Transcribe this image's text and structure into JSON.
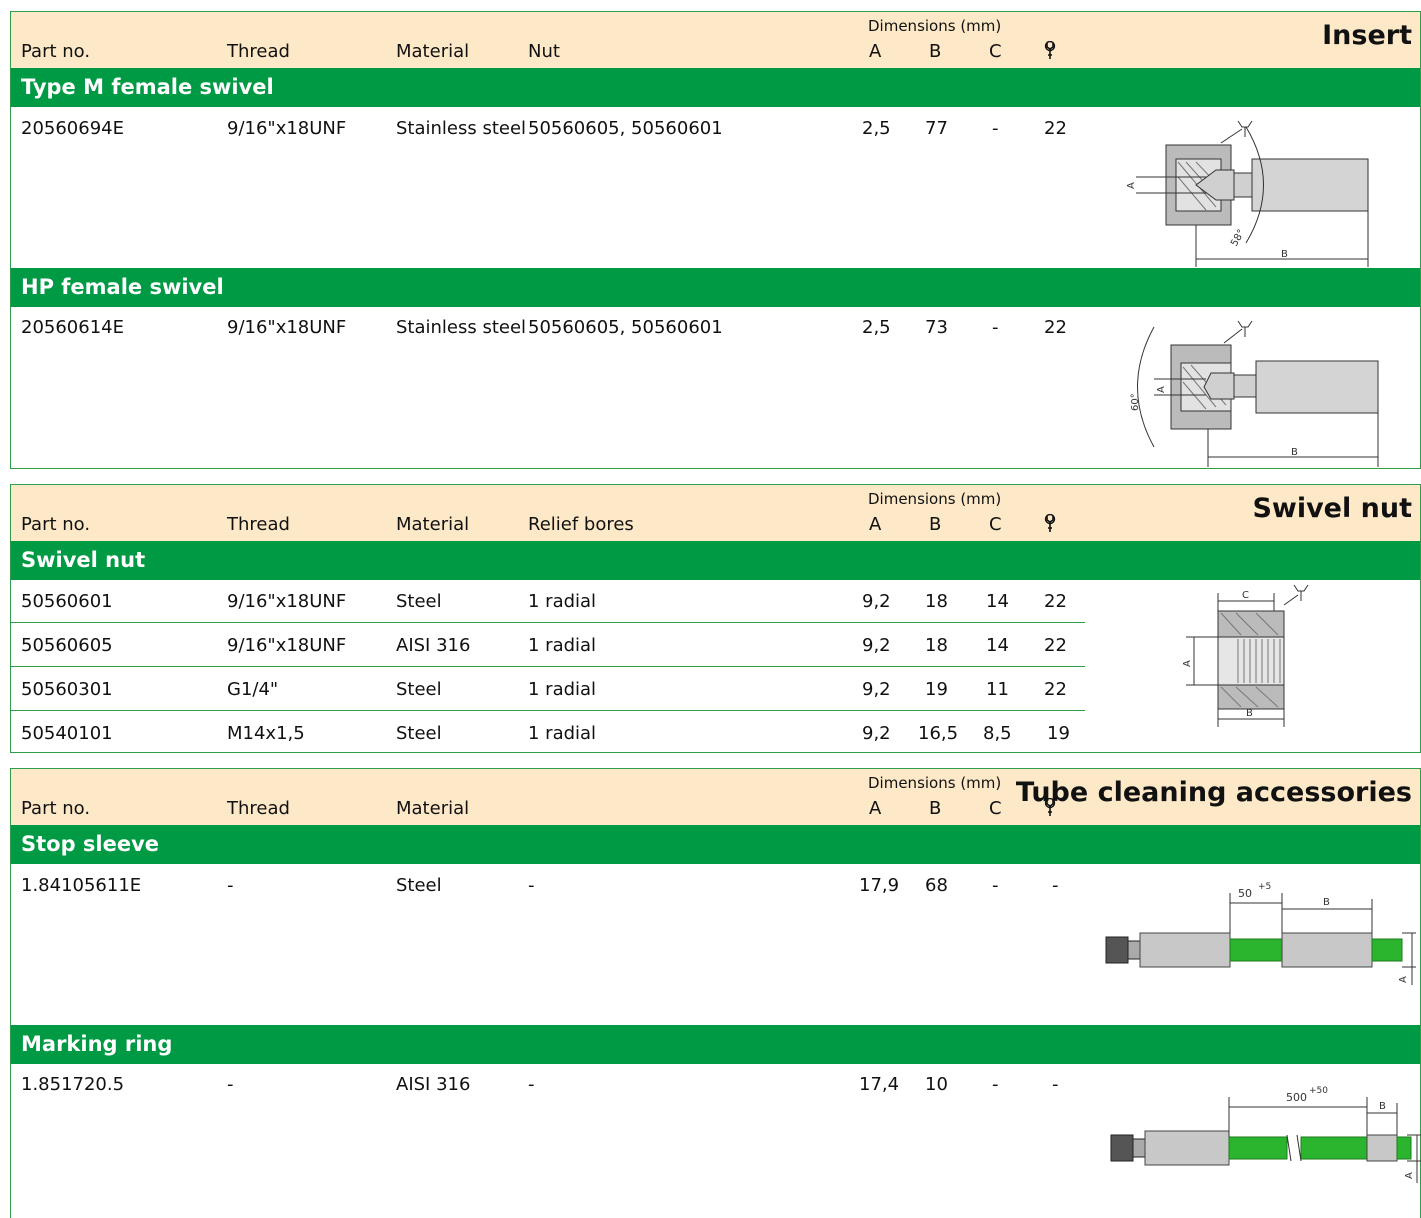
{
  "sections": [
    {
      "title": "Insert",
      "headers": {
        "part": "Part no.",
        "thread": "Thread",
        "material": "Material",
        "extra": "Nut",
        "dims": "Dimensions (mm)",
        "a": "A",
        "b": "B",
        "c": "C"
      },
      "groups": [
        {
          "name": "Type M female swivel",
          "rows": [
            {
              "part": "20560694E",
              "thread": "9/16\"x18UNF",
              "material": "Stainless steel",
              "extra": "50560605, 50560601",
              "a": "2,5",
              "b": "77",
              "c": "-",
              "w": "22"
            }
          ],
          "drawing_labels": [
            "A",
            "58°",
            "B"
          ]
        },
        {
          "name": "HP female swivel",
          "rows": [
            {
              "part": "20560614E",
              "thread": "9/16\"x18UNF",
              "material": "Stainless steel",
              "extra": "50560605, 50560601",
              "a": "2,5",
              "b": "73",
              "c": "-",
              "w": "22"
            }
          ],
          "drawing_labels": [
            "60°",
            "A",
            "B"
          ]
        }
      ]
    },
    {
      "title": "Swivel nut",
      "headers": {
        "part": "Part no.",
        "thread": "Thread",
        "material": "Material",
        "extra": "Relief bores",
        "dims": "Dimensions (mm)",
        "a": "A",
        "b": "B",
        "c": "C"
      },
      "groups": [
        {
          "name": "Swivel nut",
          "rows": [
            {
              "part": "50560601",
              "thread": "9/16\"x18UNF",
              "material": "Steel",
              "extra": "1 radial",
              "a": "9,2",
              "b": "18",
              "c": "14",
              "w": "22"
            },
            {
              "part": "50560605",
              "thread": "9/16\"x18UNF",
              "material": "AISI 316",
              "extra": "1 radial",
              "a": "9,2",
              "b": "18",
              "c": "14",
              "w": "22"
            },
            {
              "part": "50560301",
              "thread": "G1/4\"",
              "material": "Steel",
              "extra": "1 radial",
              "a": "9,2",
              "b": "19",
              "c": "11",
              "w": "22"
            },
            {
              "part": "50540101",
              "thread": "M14x1,5",
              "material": "Steel",
              "extra": "1 radial",
              "a": "9,2",
              "b": "16,5",
              "c": "8,5",
              "w": "19"
            }
          ],
          "drawing_labels": [
            "C",
            "A",
            "B"
          ]
        }
      ]
    },
    {
      "title": "Tube cleaning accessories",
      "headers": {
        "part": "Part no.",
        "thread": "Thread",
        "material": "Material",
        "extra": "",
        "dims": "Dimensions (mm)",
        "a": "A",
        "b": "B",
        "c": "C"
      },
      "groups": [
        {
          "name": "Stop sleeve",
          "rows": [
            {
              "part": "1.84105611E",
              "thread": "-",
              "material": "Steel",
              "extra": "-",
              "a": "17,9",
              "b": "68",
              "c": "-",
              "w": "-"
            }
          ],
          "drawing_labels": [
            "50",
            "+5",
            "B",
            "A"
          ]
        },
        {
          "name": "Marking ring",
          "rows": [
            {
              "part": "1.851720.5",
              "thread": "-",
              "material": "AISI 316",
              "extra": "-",
              "a": "17,4",
              "b": "10",
              "c": "-",
              "w": "-"
            }
          ],
          "drawing_labels": [
            "500",
            "+50",
            "B",
            "A"
          ]
        }
      ]
    }
  ],
  "colors": {
    "green": "#009a44",
    "header_bg": "#fde9c8",
    "border": "#2e9e4a",
    "metal": "#c8c8c8",
    "tube": "#2bb52f"
  },
  "icons": {
    "wrench": "wrench-icon"
  }
}
